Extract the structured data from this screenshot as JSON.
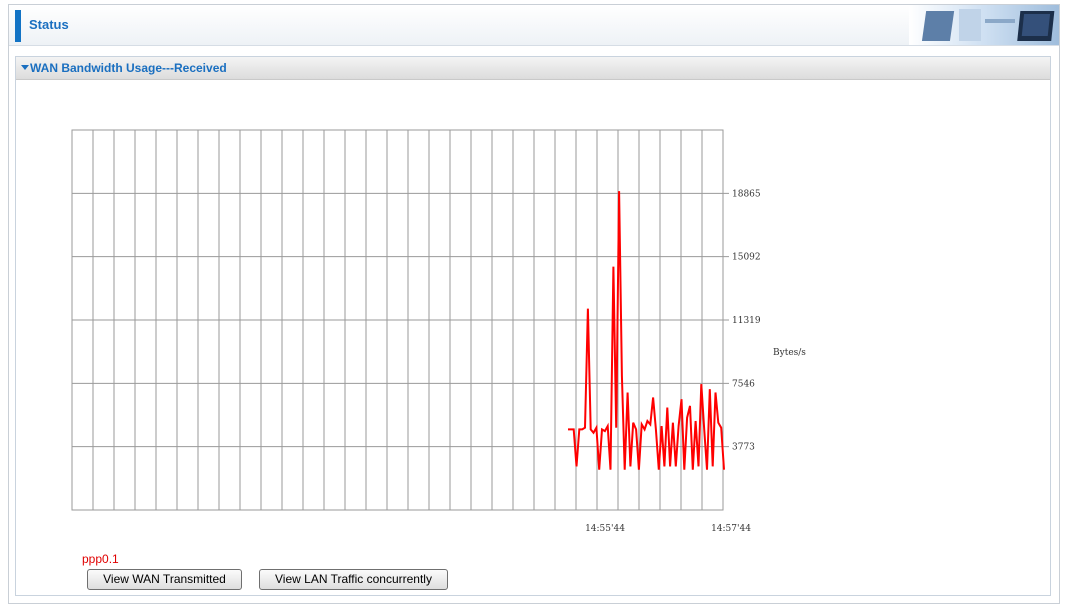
{
  "header": {
    "title": "Status"
  },
  "panel": {
    "title": "WAN Bandwidth Usage---Received"
  },
  "chart_data": {
    "type": "line",
    "title": "",
    "ylabel": "Bytes/s",
    "y_ticks": [
      18865,
      15092,
      11319,
      7546,
      3773
    ],
    "x_ticks": [
      "14:55'44",
      "14:57'44"
    ],
    "ylim": [
      0,
      22638
    ],
    "grid": true,
    "series": [
      {
        "color": "#ff0000",
        "values": [
          4800,
          4800,
          4800,
          2600,
          4800,
          4800,
          4900,
          12000,
          4800,
          4600,
          4900,
          2400,
          4800,
          4700,
          5000,
          2400,
          14500,
          4900,
          19000,
          8000,
          2400,
          7000,
          2600,
          5200,
          4800,
          2400,
          5100,
          4800,
          5300,
          5100,
          6700,
          4800,
          2400,
          5000,
          2600,
          6100,
          2600,
          5200,
          2600,
          5000,
          6600,
          2400,
          5500,
          6200,
          2400,
          5300,
          2600,
          7500,
          4900,
          2400,
          7200,
          2600,
          7000,
          5200,
          4900,
          2400
        ]
      }
    ]
  },
  "interface_label": "ppp0.1",
  "buttons": {
    "wan_transmitted": "View WAN Transmitted",
    "lan_traffic": "View LAN Traffic concurrently"
  }
}
